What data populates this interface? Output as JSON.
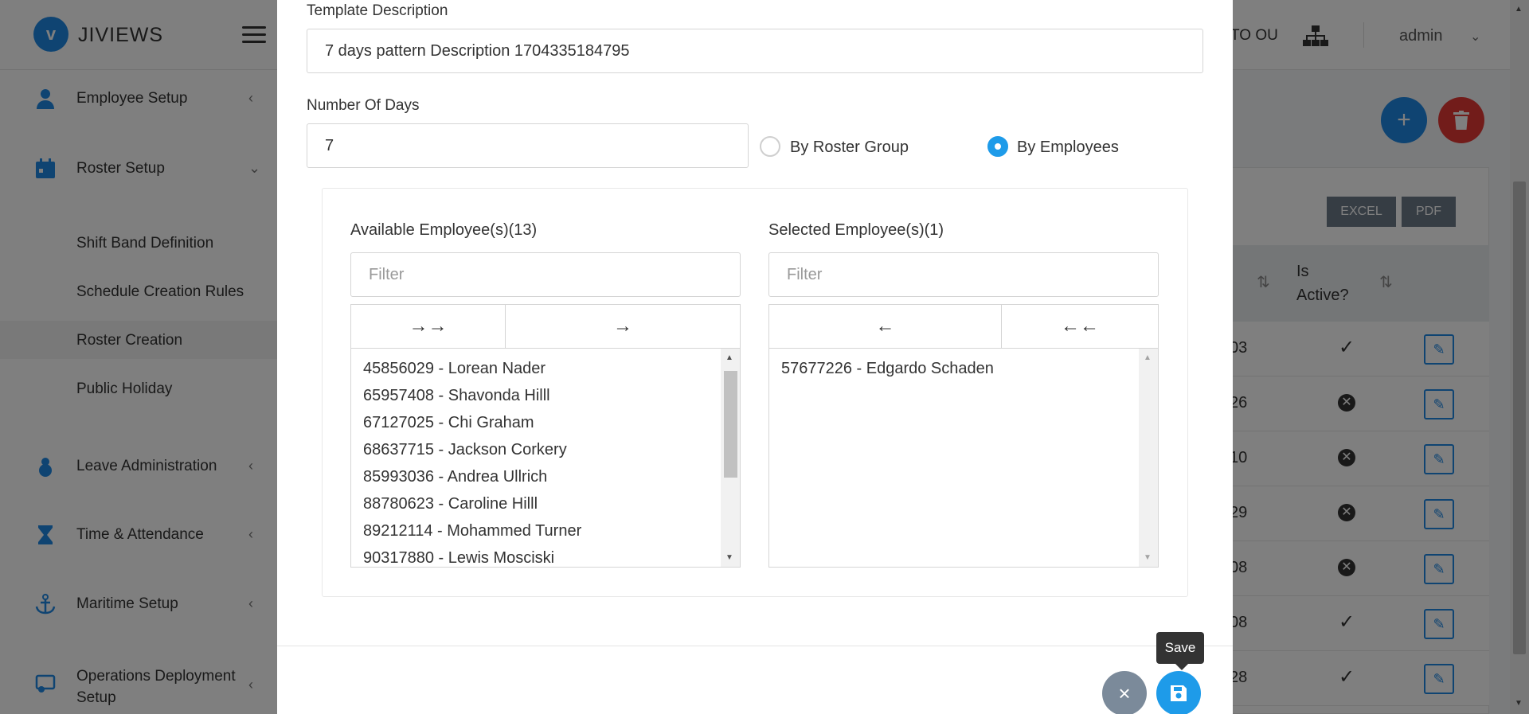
{
  "app": {
    "logo_letter": "v",
    "name": "JIVIEWS"
  },
  "topbar": {
    "ou_label": "TO OU",
    "user": "admin"
  },
  "sidebar": {
    "items": [
      {
        "label": "Employee Setup",
        "icon": "person-icon"
      },
      {
        "label": "Roster Setup",
        "icon": "calendar-icon"
      },
      {
        "label": "Leave Administration",
        "icon": "snowman-icon"
      },
      {
        "label": "Time & Attendance",
        "icon": "hourglass-icon"
      },
      {
        "label": "Maritime Setup",
        "icon": "anchor-icon"
      },
      {
        "label": "Operations Deployment Setup",
        "icon": "deployment-icon"
      }
    ],
    "roster_sub": [
      {
        "label": "Shift Band Definition"
      },
      {
        "label": "Schedule Creation Rules"
      },
      {
        "label": "Roster Creation",
        "active": true
      },
      {
        "label": "Public Holiday"
      }
    ]
  },
  "table": {
    "export_excel": "EXCEL",
    "export_pdf": "PDF",
    "header_active": "Is Active?",
    "rows": [
      {
        "num": "03",
        "active": true
      },
      {
        "num": "26",
        "active": false
      },
      {
        "num": "10",
        "active": false
      },
      {
        "num": "29",
        "active": false
      },
      {
        "num": "08",
        "active": false
      },
      {
        "num": "08",
        "active": true
      },
      {
        "num": "28",
        "active": true
      }
    ]
  },
  "modal": {
    "template_description_label": "Template Description",
    "template_description_value": "7 days pattern  Description  1704335184795",
    "number_of_days_label": "Number Of Days",
    "number_of_days_value": "7",
    "radio_roster_group": "By Roster Group",
    "radio_employees": "By Employees",
    "selected_mode": "By Employees",
    "available": {
      "caption": "Available Employee(s)(13)",
      "filter_placeholder": "Filter",
      "move_all_label": "→→",
      "move_one_label": "→",
      "items": [
        "45856029 - Lorean Nader",
        "65957408 - Shavonda Hilll",
        "67127025 - Chi Graham",
        "68637715 - Jackson Corkery",
        "85993036 - Andrea Ullrich",
        "88780623 - Caroline Hilll",
        "89212114 - Mohammed Turner",
        "90317880 - Lewis Mosciski"
      ]
    },
    "selected": {
      "caption": "Selected Employee(s)(1)",
      "filter_placeholder": "Filter",
      "remove_one_label": "←",
      "remove_all_label": "←←",
      "items": [
        "57677226 - Edgardo Schaden"
      ]
    },
    "close_icon": "×",
    "save_tooltip": "Save"
  },
  "colors": {
    "primary": "#1e9be9",
    "danger": "#e53935",
    "overlay": "rgba(0,0,0,0.5)",
    "close_button": "#7b8a9a"
  }
}
